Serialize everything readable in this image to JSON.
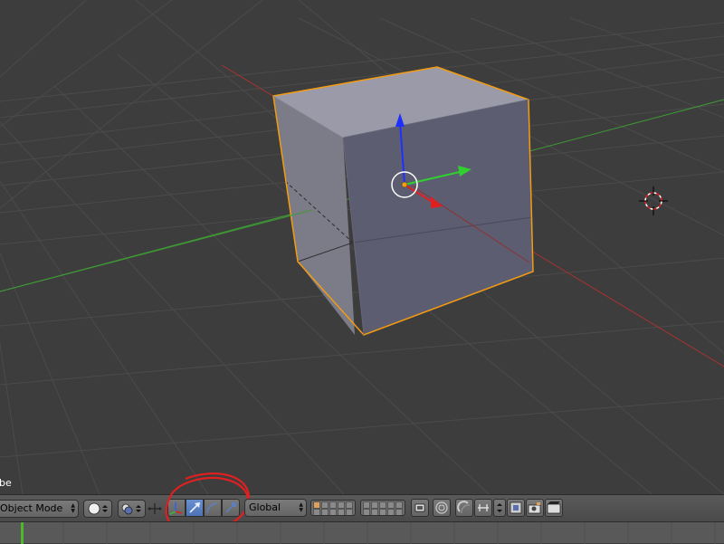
{
  "viewport": {
    "object_label": "be",
    "colors": {
      "background": "#3d3d3d",
      "grid": "#4a4a4a",
      "x_axis": "#c23a3a",
      "y_axis": "#49b53f",
      "selection_outline": "#f39c12",
      "cube_face_top": "#9a9aa9",
      "cube_face_front": "#5d5d72",
      "cube_face_left": "#7c7c89"
    },
    "icons": {
      "gizmo": "transform-gizmo-icon",
      "cursor": "3d-cursor-icon"
    }
  },
  "header": {
    "mode_select": {
      "value": "Object Mode"
    },
    "shading_select": {
      "icon": "solid-sphere-icon"
    },
    "pivot_select": {
      "icon": "pivot-point-icon"
    },
    "manipulator_toggle": {
      "icon": "manipulator-axes-icon"
    },
    "manipulator_modes": [
      {
        "name": "translate",
        "icon": "translate-arrow-icon",
        "active": true
      },
      {
        "name": "rotate",
        "icon": "rotate-arc-icon",
        "active": false
      },
      {
        "name": "scale",
        "icon": "scale-handle-icon",
        "active": false
      }
    ],
    "orientation_select": {
      "value": "Global"
    },
    "layers_icon": "layer-grid-icon",
    "right_icons": [
      "lock-layers-icon",
      "proportional-edit-icon",
      "snap-magnet-icon",
      "snap-element-icon",
      "snap-target-icon",
      "render-opengl-icon",
      "render-animation-icon"
    ],
    "colors": {
      "annotation_circle": "#e02020",
      "active_button": "#5680c2"
    }
  },
  "timeline": {
    "current_frame_marker_color": "#4fb82a"
  }
}
